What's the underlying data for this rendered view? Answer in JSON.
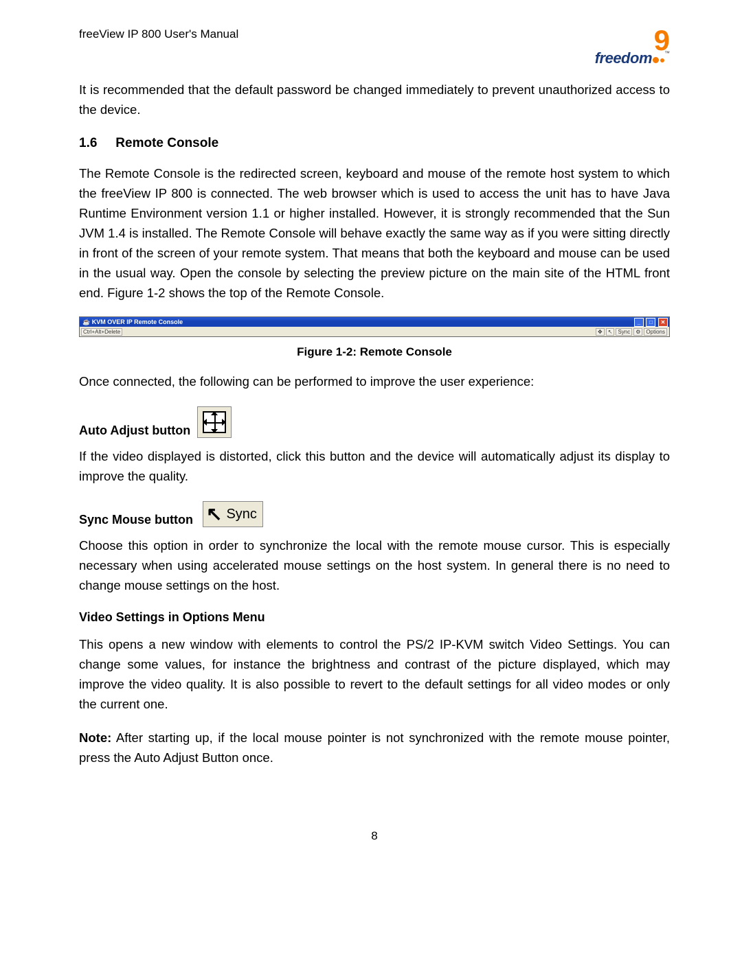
{
  "running_head": "freeView IP 800 User's Manual",
  "logo": {
    "brand": "freedom",
    "glyph": "9",
    "tm": "™"
  },
  "intro_para": "It is recommended that the default password be changed immediately to prevent unauthorized access to the device.",
  "section": {
    "number": "1.6",
    "title": "Remote Console"
  },
  "section_para": "The Remote Console is the redirected screen, keyboard and mouse of the remote host system to which the freeView IP 800 is connected. The web browser which is used to access the unit has to have Java Runtime Environment version 1.1 or higher installed. However, it is strongly recommended that the Sun JVM 1.4 is installed. The Remote Console will behave exactly the same way as if you were sitting directly in front of the screen of your remote system. That means that both the keyboard and mouse can be used in the usual way. Open the console by selecting the preview picture on the main site of the HTML front end. Figure 1-2 shows the top of the Remote Console.",
  "figure": {
    "window_title": "KVM OVER IP Remote Console",
    "toolbar_left": "Ctrl+Alt+Delete",
    "toolbar_right": {
      "sync": "Sync",
      "options": "Options"
    },
    "caption": "Figure 1-2: Remote Console"
  },
  "post_figure": "Once connected, the following can be performed to improve the user experience:",
  "auto_adjust": {
    "label": "Auto Adjust button",
    "para": "If the video displayed is distorted, click this button and the device will automatically adjust its display to improve the quality."
  },
  "sync_mouse": {
    "label": "Sync Mouse button",
    "icon_text": "Sync",
    "para": "Choose this option in order to synchronize the local with the remote mouse cursor. This is especially necessary when using accelerated mouse settings on the host system. In general there is no need to change mouse settings on the host."
  },
  "video_settings": {
    "heading": "Video Settings in Options Menu",
    "para": "This opens a new window with elements to control the PS/2 IP-KVM switch Video Settings. You can change some values, for instance the brightness and contrast of the picture displayed, which may improve the video quality. It is also possible to revert to the default settings for all video modes or only the current one."
  },
  "note": {
    "label": "Note:",
    "text": " After starting up, if the local mouse pointer is not synchronized with the remote mouse pointer, press the Auto Adjust Button once."
  },
  "page_number": "8"
}
